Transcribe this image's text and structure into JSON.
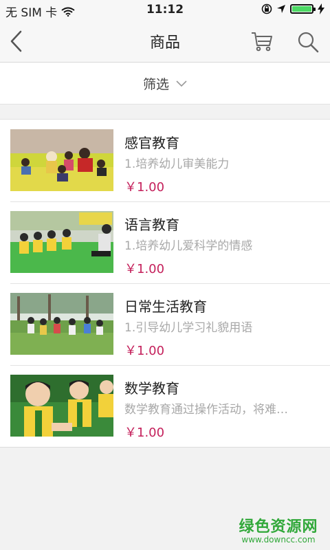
{
  "status_bar": {
    "carrier": "无 SIM 卡",
    "time": "11:12",
    "battery_level": 1.0,
    "icons": [
      "wifi-icon",
      "orientation-lock-icon",
      "location-arrow-icon",
      "battery-icon",
      "charging-bolt-icon"
    ]
  },
  "nav": {
    "title": "商品",
    "icons": [
      "back-chevron-icon",
      "cart-icon",
      "search-icon"
    ]
  },
  "filter": {
    "label": "筛选",
    "icon": "chevron-down-icon"
  },
  "products": [
    {
      "title": "感官教育",
      "desc": "1.培养幼儿审美能力",
      "price": "￥1.00"
    },
    {
      "title": "语言教育",
      "desc": "1.培养幼儿爱科学的情感",
      "price": "￥1.00"
    },
    {
      "title": "日常生活教育",
      "desc": "1.引导幼儿学习礼貌用语",
      "price": "￥1.00"
    },
    {
      "title": "数学教育",
      "desc": "数学教育通过操作活动，将难…",
      "price": "￥1.00"
    }
  ],
  "watermark": {
    "main": "绿色资源网",
    "sub": "www.downcc.com"
  },
  "colors": {
    "price": "#c4205b",
    "battery": "#4cd964",
    "watermark": "#31a83a"
  }
}
